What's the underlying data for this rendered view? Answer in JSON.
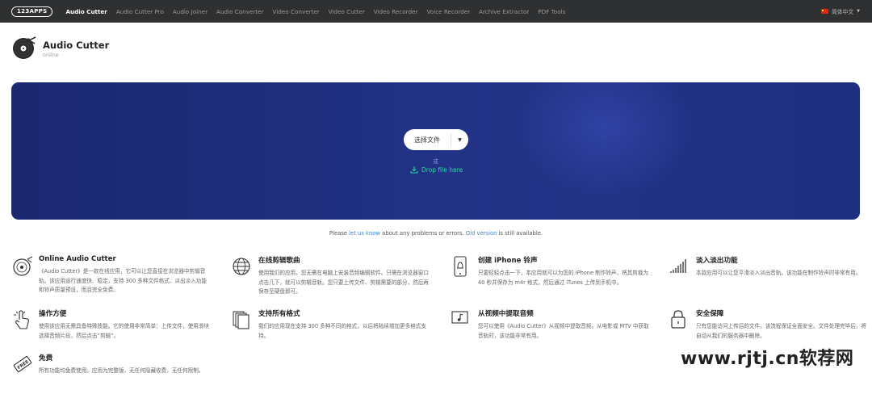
{
  "nav": {
    "brand": "123APPS",
    "links": [
      "Audio Cutter",
      "Audio Cutter Pro",
      "Audio Joiner",
      "Audio Converter",
      "Video Converter",
      "Video Cutter",
      "Video Recorder",
      "Voice Recorder",
      "Archive Extractor",
      "PDF Tools"
    ],
    "active_index": 0,
    "language": "简体中文"
  },
  "header": {
    "title": "Audio Cutter",
    "status": "online"
  },
  "upload": {
    "choose_label": "选择文件",
    "or_text": "或",
    "drop_text": "Drop file here"
  },
  "notice": {
    "prefix": "Please ",
    "link1": "let us know",
    "middle": " about any problems or errors. ",
    "link2": "Old version",
    "suffix": " is still available."
  },
  "features": [
    {
      "icon": "vinyl-icon",
      "title": "Online Audio Cutter",
      "text": "《Audio Cutter》是一款在线应用，它可以让您直接在浏览器中剪辑音轨。该应用运行速度快、稳定，支持 300 多种文件格式、淡出淡入功能和铃声质量预设，而且完全免费。"
    },
    {
      "icon": "globe-icon",
      "title": "在线剪辑歌曲",
      "text": "使用我们的应用，您无需在电脑上安装音频编辑软件。只需在浏览器窗口点击几下，就可以剪辑音轨。您只要上传文件、剪辑需要的部分，然后再保存至硬盘即可。"
    },
    {
      "icon": "phone-bell-icon",
      "title": "创建 iPhone 铃声",
      "text": "只要轻轻点击一下，本应用就可以为您的 iPhone 制作铃声，将其剪裁为 40 秒并保存为 m4r 格式，然后通过 iTunes 上传到手机中。"
    },
    {
      "icon": "fade-bars-icon",
      "title": "淡入淡出功能",
      "text": "本款应用可以让您平滑淡入淡出音轨。该功能在制作铃声时非常有用。"
    },
    {
      "icon": "hand-pointer-icon",
      "title": "操作方便",
      "text": "使用该应用无需具备特殊技能。它的使用非常简单：上传文件，使用滑块选择音频片段，然后点击“剪辑”。"
    },
    {
      "icon": "documents-icon",
      "title": "支持所有格式",
      "text": "我们的应用现在支持 300 多种不同的格式，以后将陆续增加更多格式支持。"
    },
    {
      "icon": "music-note-icon",
      "title": "从视频中提取音频",
      "text": "您可以使用《Audio Cutter》从视频中提取音频。从电影或 MTV 中获取音轨时，该功能非常有用。"
    },
    {
      "icon": "lock-icon",
      "title": "安全保障",
      "text": "只有您能访问上传后的文件。该流程保证全面安全。文件处理完毕后，将自动从我们的服务器中删除。"
    },
    {
      "icon": "free-tag-icon",
      "title": "免费",
      "text": "所有功能均免费使用。应用为完整版，无任何隐藏收费，无任何限制。"
    }
  ],
  "watermark": "www.rjtj.cn软荐网",
  "colors": {
    "nav_bg": "#2f3031",
    "hero_bg": "#223387",
    "accent_green": "#33d3a0",
    "link_blue": "#3b87d6"
  }
}
